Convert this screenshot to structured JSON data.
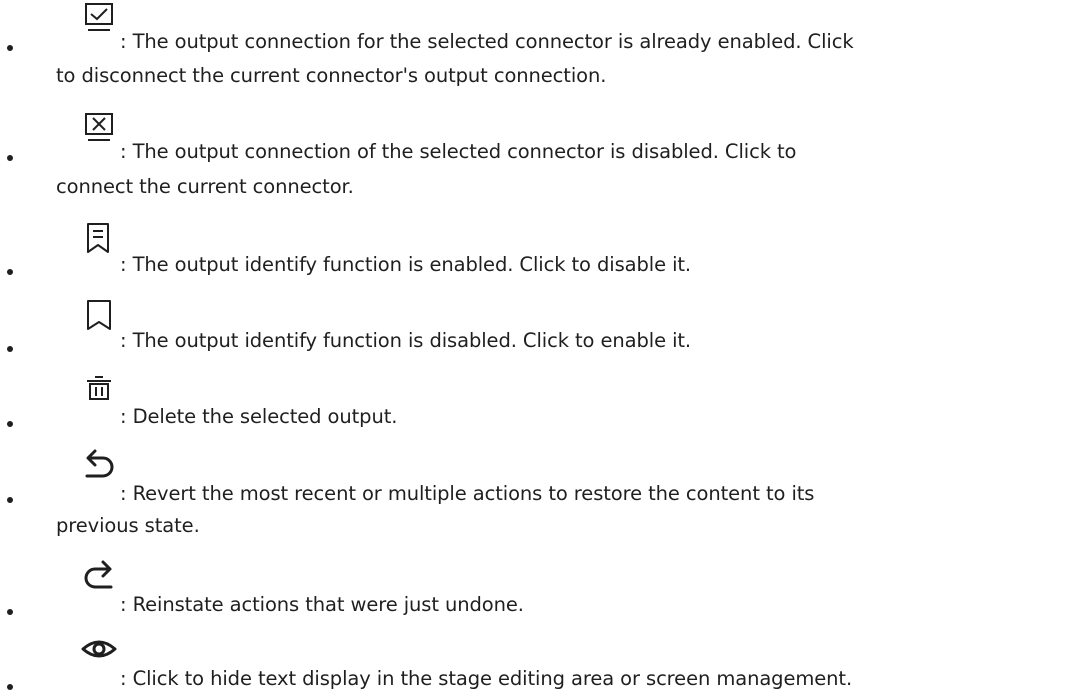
{
  "items": [
    {
      "icon": "checkbox-checked-icon",
      "lines": [
        ": The output connection for the selected connector is already enabled. Click",
        "to disconnect the current connector's output connection."
      ]
    },
    {
      "icon": "checkbox-x-icon",
      "lines": [
        ": The output connection of the selected connector is disabled. Click to",
        "connect the current connector."
      ]
    },
    {
      "icon": "bookmark-lines-icon",
      "lines": [
        ": The output identify function is enabled. Click to disable it."
      ]
    },
    {
      "icon": "bookmark-icon",
      "lines": [
        ": The output identify function is disabled. Click to enable it."
      ]
    },
    {
      "icon": "trash-icon",
      "lines": [
        ": Delete the selected output."
      ]
    },
    {
      "icon": "undo-icon",
      "lines": [
        ": Revert the most recent or multiple actions to restore the content to its",
        "previous state."
      ]
    },
    {
      "icon": "redo-icon",
      "lines": [
        ": Reinstate actions that were just undone."
      ]
    },
    {
      "icon": "eye-icon",
      "lines": [
        ": Click to hide text display in the stage editing area or screen management."
      ]
    }
  ]
}
